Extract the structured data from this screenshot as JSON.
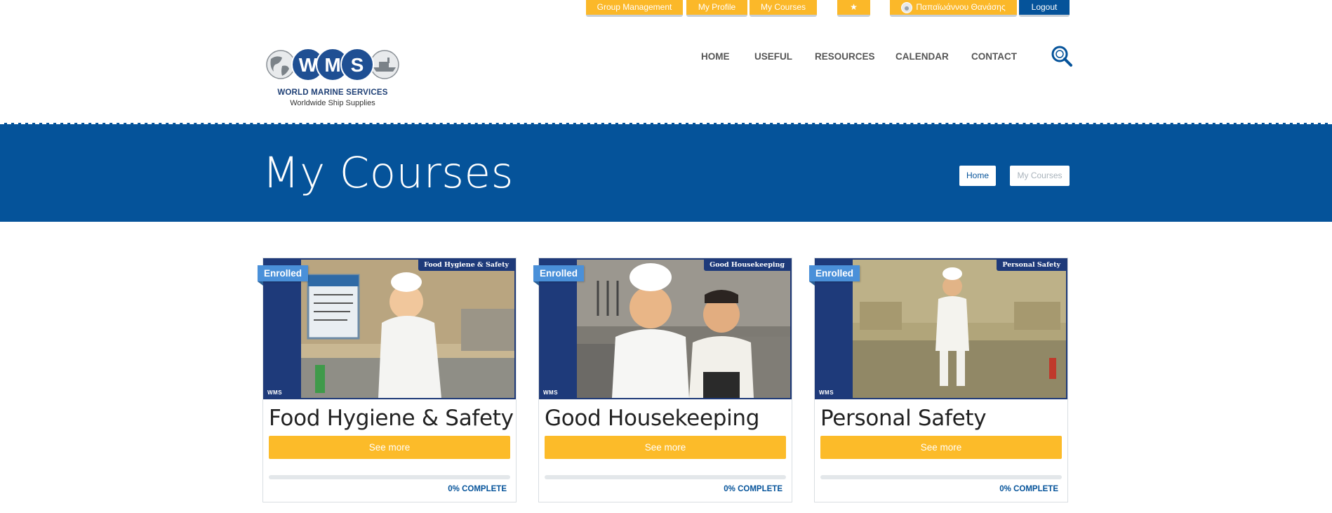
{
  "topbar": {
    "group_management": "Group Management",
    "my_profile": "My Profile",
    "my_courses": "My Courses",
    "favorites_icon": "star-icon",
    "user_name": "Παπαϊωάννου Θανάσης",
    "logout": "Logout"
  },
  "header": {
    "logo_text": "WMS",
    "logo_letters": [
      "W",
      "M",
      "S"
    ],
    "brand_name": "WORLD MARINE SERVICES",
    "brand_tagline": "Worldwide Ship Supplies",
    "nav": [
      "HOME",
      "USEFUL",
      "RESOURCES",
      "CALENDAR",
      "CONTACT"
    ],
    "search_icon": "search-icon"
  },
  "banner": {
    "title": "My Courses",
    "breadcrumb": {
      "home": "Home",
      "current": "My Courses"
    }
  },
  "courses": [
    {
      "title": "Food Hygiene & Safety",
      "badge": "Enrolled",
      "thumb_tag": "Food Hygiene & Safety",
      "button": "See more",
      "progress_label": "0% COMPLETE",
      "progress": 0
    },
    {
      "title": "Good Housekeeping",
      "badge": "Enrolled",
      "thumb_tag": "Good Housekeeping",
      "button": "See more",
      "progress_label": "0% COMPLETE",
      "progress": 0
    },
    {
      "title": "Personal Safety",
      "badge": "Enrolled",
      "thumb_tag": "Personal Safety",
      "button": "See more",
      "progress_label": "0% COMPLETE",
      "progress": 0
    }
  ],
  "colors": {
    "accent_yellow": "#fbb829",
    "primary_blue": "#05539a",
    "badge_blue": "#4a90d9"
  }
}
